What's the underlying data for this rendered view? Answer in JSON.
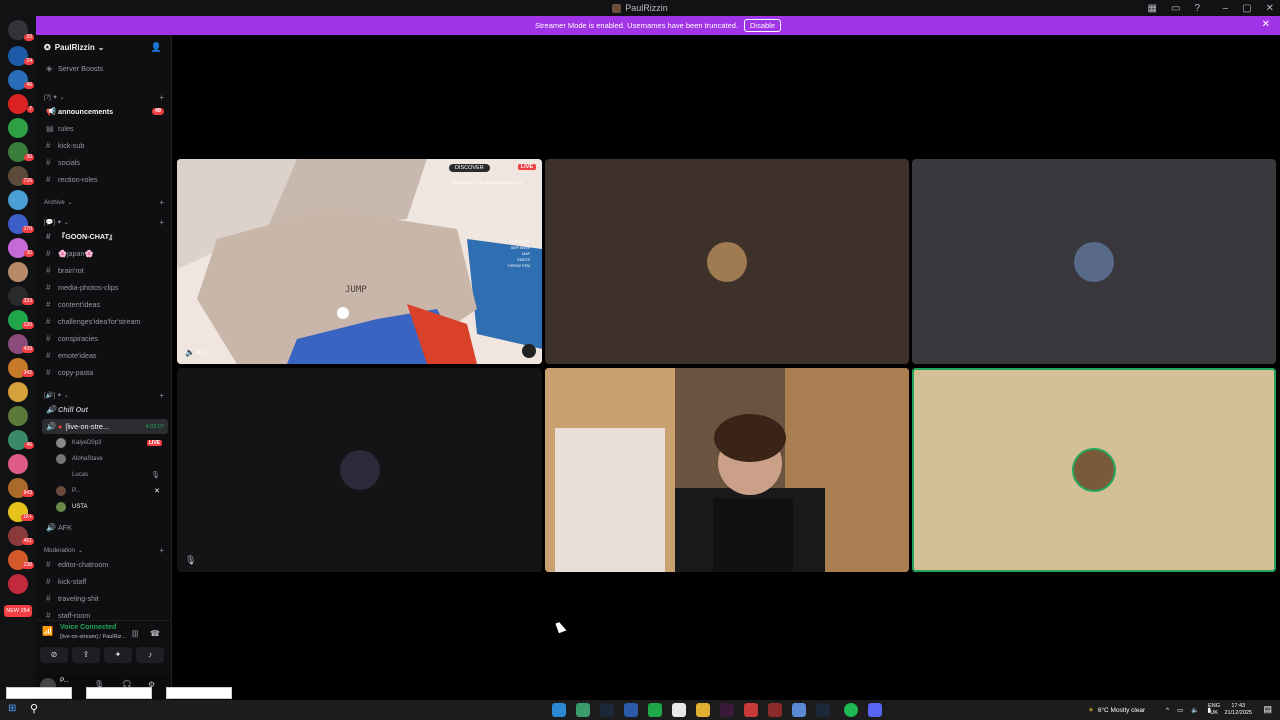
{
  "window": {
    "title": "PaulRizzin"
  },
  "banner": {
    "text": "Streamer Mode is enabled. Usernames have been truncated.",
    "button": "Disable",
    "color": "#a134e6"
  },
  "rail": {
    "badges": [
      "20",
      "24",
      "46",
      "7",
      "30",
      "726",
      "170",
      "30",
      "333",
      "130",
      "439",
      "342",
      "46",
      "843",
      "1K+",
      "461",
      "238",
      "264"
    ],
    "new_label": "NEW"
  },
  "server": {
    "name": "PaulRizzin",
    "boosts": "Server Boosts"
  },
  "channels": {
    "cat1": "[?] ✦ ⌄",
    "announcements": "announcements",
    "announcements_count": "48",
    "rules": "rules",
    "kick_sub": "kick-sub",
    "socials": "socials",
    "rection_roles": "rection-roles",
    "archive": "Archive",
    "cat2": "[💬] ✦ ⌄",
    "goon_chat": "『GOON-CHAT』",
    "japan": "🌸japan🌸",
    "brain_rot": "brain'rot",
    "media": "media-photos-clips",
    "content_ideas": "content'ideas",
    "challenges": "challenges'idea'for'stream",
    "conspiracies": "conspiracies",
    "emote_ideas": "emote'ideas",
    "copy_pasta": "copy-pasta",
    "cat3": "[🔊] ✦ ⌄",
    "chill_out": "Chill Out",
    "live_on_stream": "[live-on-stre...",
    "live_timer": "4:03:07",
    "afk": "AFK",
    "moderation": "Moderation",
    "editor_chatroom": "editor-chatroom",
    "kick_staff": "kick-staff",
    "traveling": "traveling-shit",
    "staff_room": "staff-room"
  },
  "voice_users": [
    {
      "name": "KalyeD0p3",
      "live": "LIVE"
    },
    {
      "name": "AlohaStave"
    },
    {
      "name": "Lucas"
    },
    {
      "name": "P..."
    },
    {
      "name": "USTA"
    }
  ],
  "voice_panel": {
    "status": "Voice Connected",
    "channel": "[live-on-stream] / PaulRiz..."
  },
  "user_panel": {
    "name": "P..."
  },
  "stage": {
    "game_live": "LIVE",
    "game_discover": "DISCOVER",
    "game_hud": "EXPLORE THE ABANDONED HUT",
    "game_text": "JUMP",
    "hud_list": [
      "INVENTORY",
      "SKIP MOVE",
      "MAP",
      "EMOTE",
      "THROW ITEM"
    ]
  },
  "tray": {
    "weather": "6°C  Mostly clear",
    "lang1": "ENG",
    "lang2": "UK",
    "time": "17:43",
    "date": "21/12/2025"
  },
  "colors": {
    "accent": "#5865f2",
    "live": "#f23f43",
    "connected": "#23a55a"
  }
}
